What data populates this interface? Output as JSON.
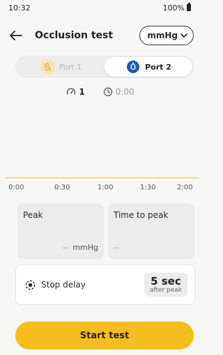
{
  "status_bar": {
    "time": "10:32",
    "battery": "100%"
  },
  "app_bar": {
    "title": "Occlusion test",
    "unit": "mmHg"
  },
  "ports": [
    {
      "label": "Port 1",
      "active": false
    },
    {
      "label": "Port 2",
      "active": true
    }
  ],
  "stats": {
    "count": "1",
    "time": "0:00"
  },
  "axis_ticks": [
    "0:00",
    "0:30",
    "1:00",
    "1:30",
    "2:00"
  ],
  "peak": {
    "label": "Peak",
    "value": "--",
    "unit": "mmHg"
  },
  "time_to_peak": {
    "label": "Time to peak",
    "value": "--"
  },
  "stop_delay": {
    "label": "Stop delay",
    "value": "5 sec",
    "sub": "after peak"
  },
  "start_button": {
    "label": "Start test"
  },
  "colors": {
    "accent": "#f6bd1e",
    "port2_blue": "#1f5fa8",
    "chart_line": "#f5c033"
  }
}
